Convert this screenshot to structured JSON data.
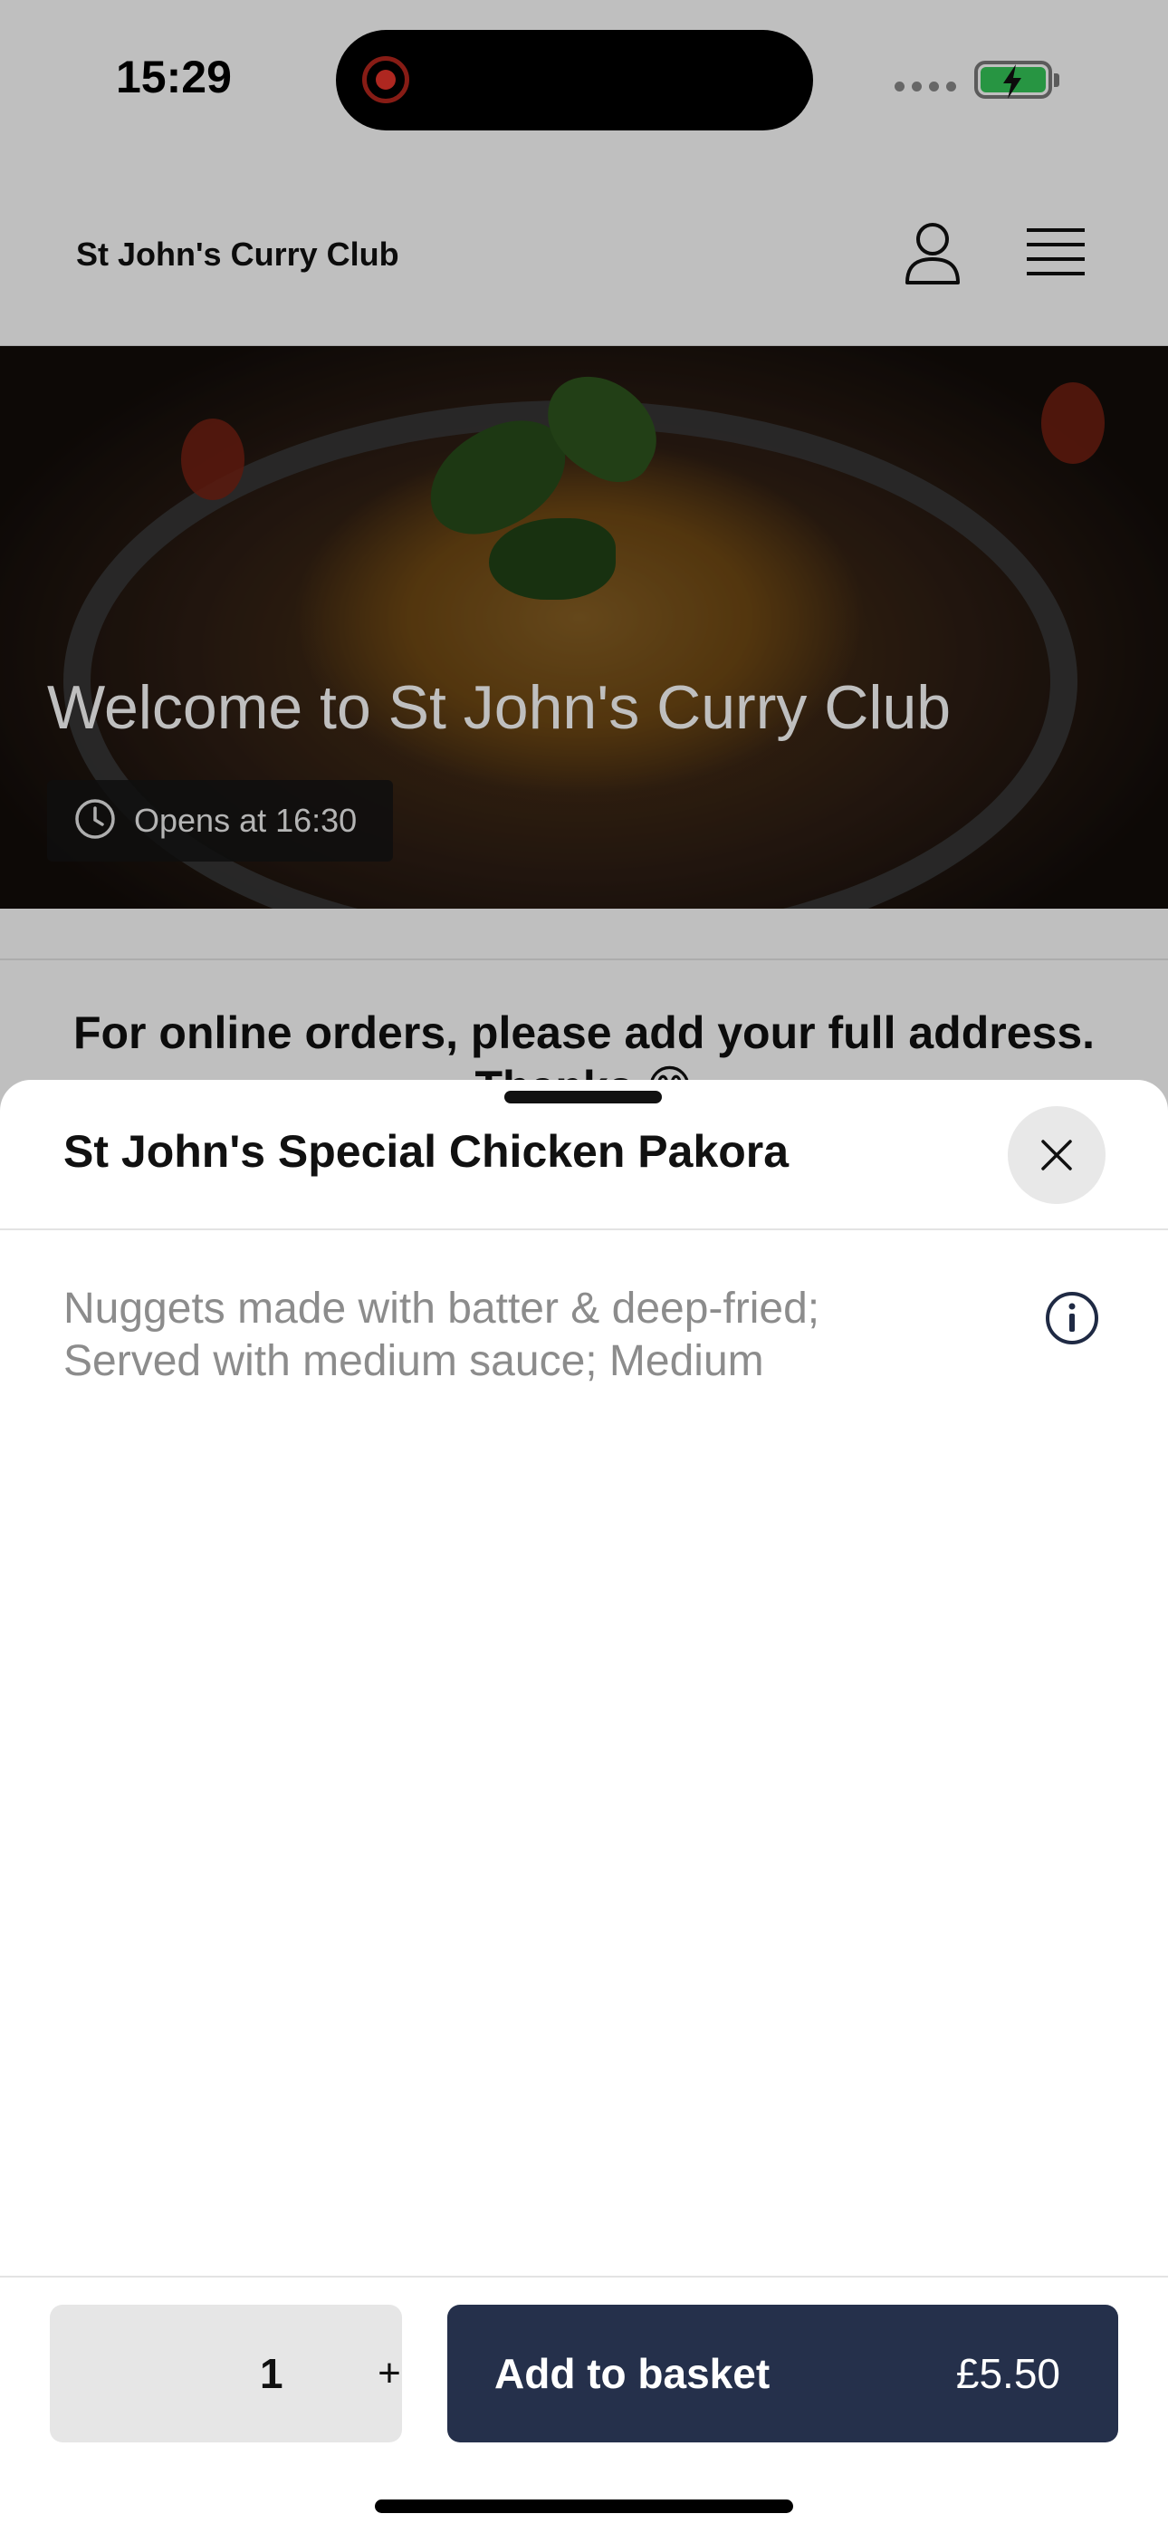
{
  "status_bar": {
    "time": "15:29"
  },
  "header": {
    "site_name": "St John's Curry Club",
    "account_icon": "person-icon",
    "menu_icon": "hamburger-menu-icon"
  },
  "hero": {
    "title": "Welcome to St John's Curry Club",
    "opens_label": "Opens at 16:30",
    "clock_icon": "clock-icon"
  },
  "notice": {
    "text": "For online orders, please add your full address. Thanks 😊"
  },
  "sheet": {
    "title": "St John's Special Chicken Pakora",
    "close_icon": "close-icon",
    "description": "Nuggets made with batter & deep-fried; Served with medium sauce; Medium",
    "info_icon": "info-icon"
  },
  "footer": {
    "quantity": "1",
    "plus_label": "+",
    "add_label": "Add to basket",
    "price": "£5.50"
  },
  "colors": {
    "primary_button": "#25304b",
    "battery_green": "#34c759",
    "recording_red": "#e8342b"
  }
}
